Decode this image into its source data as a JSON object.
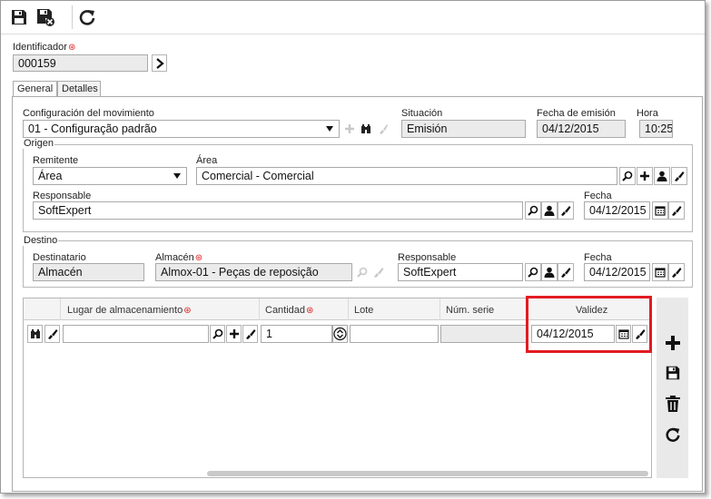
{
  "toolbar": {
    "icons": [
      "save-icon",
      "save-close-icon",
      "refresh-icon"
    ]
  },
  "identificador": {
    "label": "Identificador",
    "value": "000159"
  },
  "tabs": [
    {
      "label": "General",
      "active": true
    },
    {
      "label": "Detalles",
      "active": false
    }
  ],
  "general": {
    "config_label": "Configuración del movimiento",
    "config_value": "01 - Configuração padrão",
    "situacion_label": "Situación",
    "situacion_value": "Emisión",
    "fecha_emision_label": "Fecha de emisión",
    "fecha_emision_value": "04/12/2015",
    "hora_label": "Hora",
    "hora_value": "10:25"
  },
  "origen": {
    "title": "Origen",
    "remitente_label": "Remitente",
    "remitente_value": "Área",
    "area_label": "Área",
    "area_value": "Comercial - Comercial",
    "responsable_label": "Responsable",
    "responsable_value": "SoftExpert",
    "fecha_label": "Fecha",
    "fecha_value": "04/12/2015"
  },
  "destino": {
    "title": "Destino",
    "destinatario_label": "Destinatario",
    "destinatario_value": "Almacén",
    "almacen_label": "Almacén",
    "almacen_value": "Almox-01 - Peças de reposição",
    "responsable_label": "Responsable",
    "responsable_value": "SoftExpert",
    "fecha_label": "Fecha",
    "fecha_value": "04/12/2015"
  },
  "grid": {
    "columns": [
      "Lugar de almacenamiento",
      "Cantidad",
      "Lote",
      "Núm. serie",
      "Validez"
    ],
    "row": {
      "lugar": "",
      "cantidad": "1",
      "lote": "",
      "num_serie": "",
      "validez": "04/12/2015"
    }
  },
  "side_actions": [
    "add-icon",
    "save-icon",
    "delete-icon",
    "refresh-icon"
  ],
  "colors": {
    "highlight": "#e21b22",
    "required": "#d22222"
  }
}
